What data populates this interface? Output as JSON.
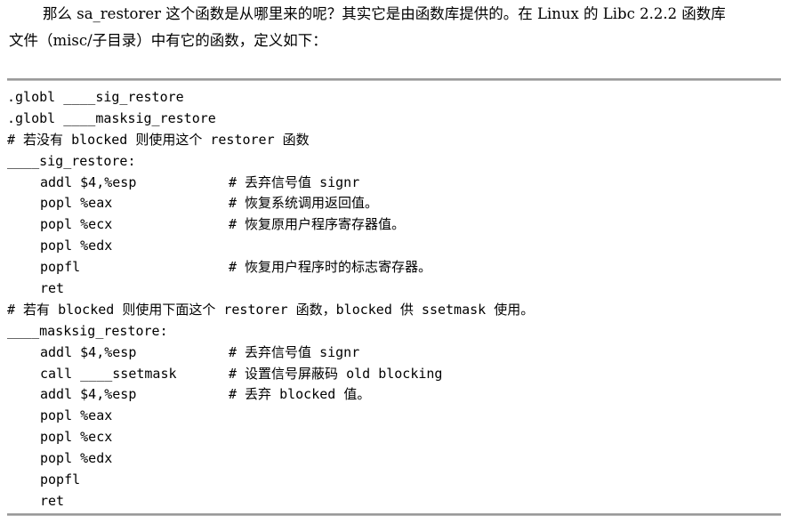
{
  "intro": {
    "line1": "那么 sa_restorer 这个函数是从哪里来的呢？其实它是由函数库提供的。在 Linux 的 Libc 2.2.2 函数库",
    "line2": "文件（misc/子目录）中有它的函数，定义如下："
  },
  "code": [
    {
      "code": ".globl ____sig_restore",
      "comment": "",
      "indent": false
    },
    {
      "code": ".globl ____masksig_restore",
      "comment": "",
      "indent": false
    },
    {
      "code": "# 若没有 blocked 则使用这个 restorer 函数",
      "comment": "",
      "indent": false
    },
    {
      "code": "____sig_restore:",
      "comment": "",
      "indent": false
    },
    {
      "code": "addl $4,%esp",
      "comment": "# 丢弃信号值 signr",
      "indent": true
    },
    {
      "code": "popl %eax",
      "comment": "# 恢复系统调用返回值。",
      "indent": true
    },
    {
      "code": "popl %ecx",
      "comment": "# 恢复原用户程序寄存器值。",
      "indent": true
    },
    {
      "code": "popl %edx",
      "comment": "",
      "indent": true
    },
    {
      "code": "popfl",
      "comment": "# 恢复用户程序时的标志寄存器。",
      "indent": true
    },
    {
      "code": "ret",
      "comment": "",
      "indent": true
    },
    {
      "code": "# 若有 blocked 则使用下面这个 restorer 函数，blocked 供 ssetmask 使用。",
      "comment": "",
      "indent": false
    },
    {
      "code": "____masksig_restore:",
      "comment": "",
      "indent": false
    },
    {
      "code": "addl $4,%esp",
      "comment": "# 丢弃信号值 signr",
      "indent": true
    },
    {
      "code": "call ____ssetmask",
      "comment": "# 设置信号屏蔽码 old blocking",
      "indent": true
    },
    {
      "code": "addl $4,%esp",
      "comment": "# 丢弃 blocked 值。",
      "indent": true
    },
    {
      "code": "popl %eax",
      "comment": "",
      "indent": true
    },
    {
      "code": "popl %ecx",
      "comment": "",
      "indent": true
    },
    {
      "code": "popl %edx",
      "comment": "",
      "indent": true
    },
    {
      "code": "popfl",
      "comment": "",
      "indent": true
    },
    {
      "code": "ret",
      "comment": "",
      "indent": true
    }
  ]
}
